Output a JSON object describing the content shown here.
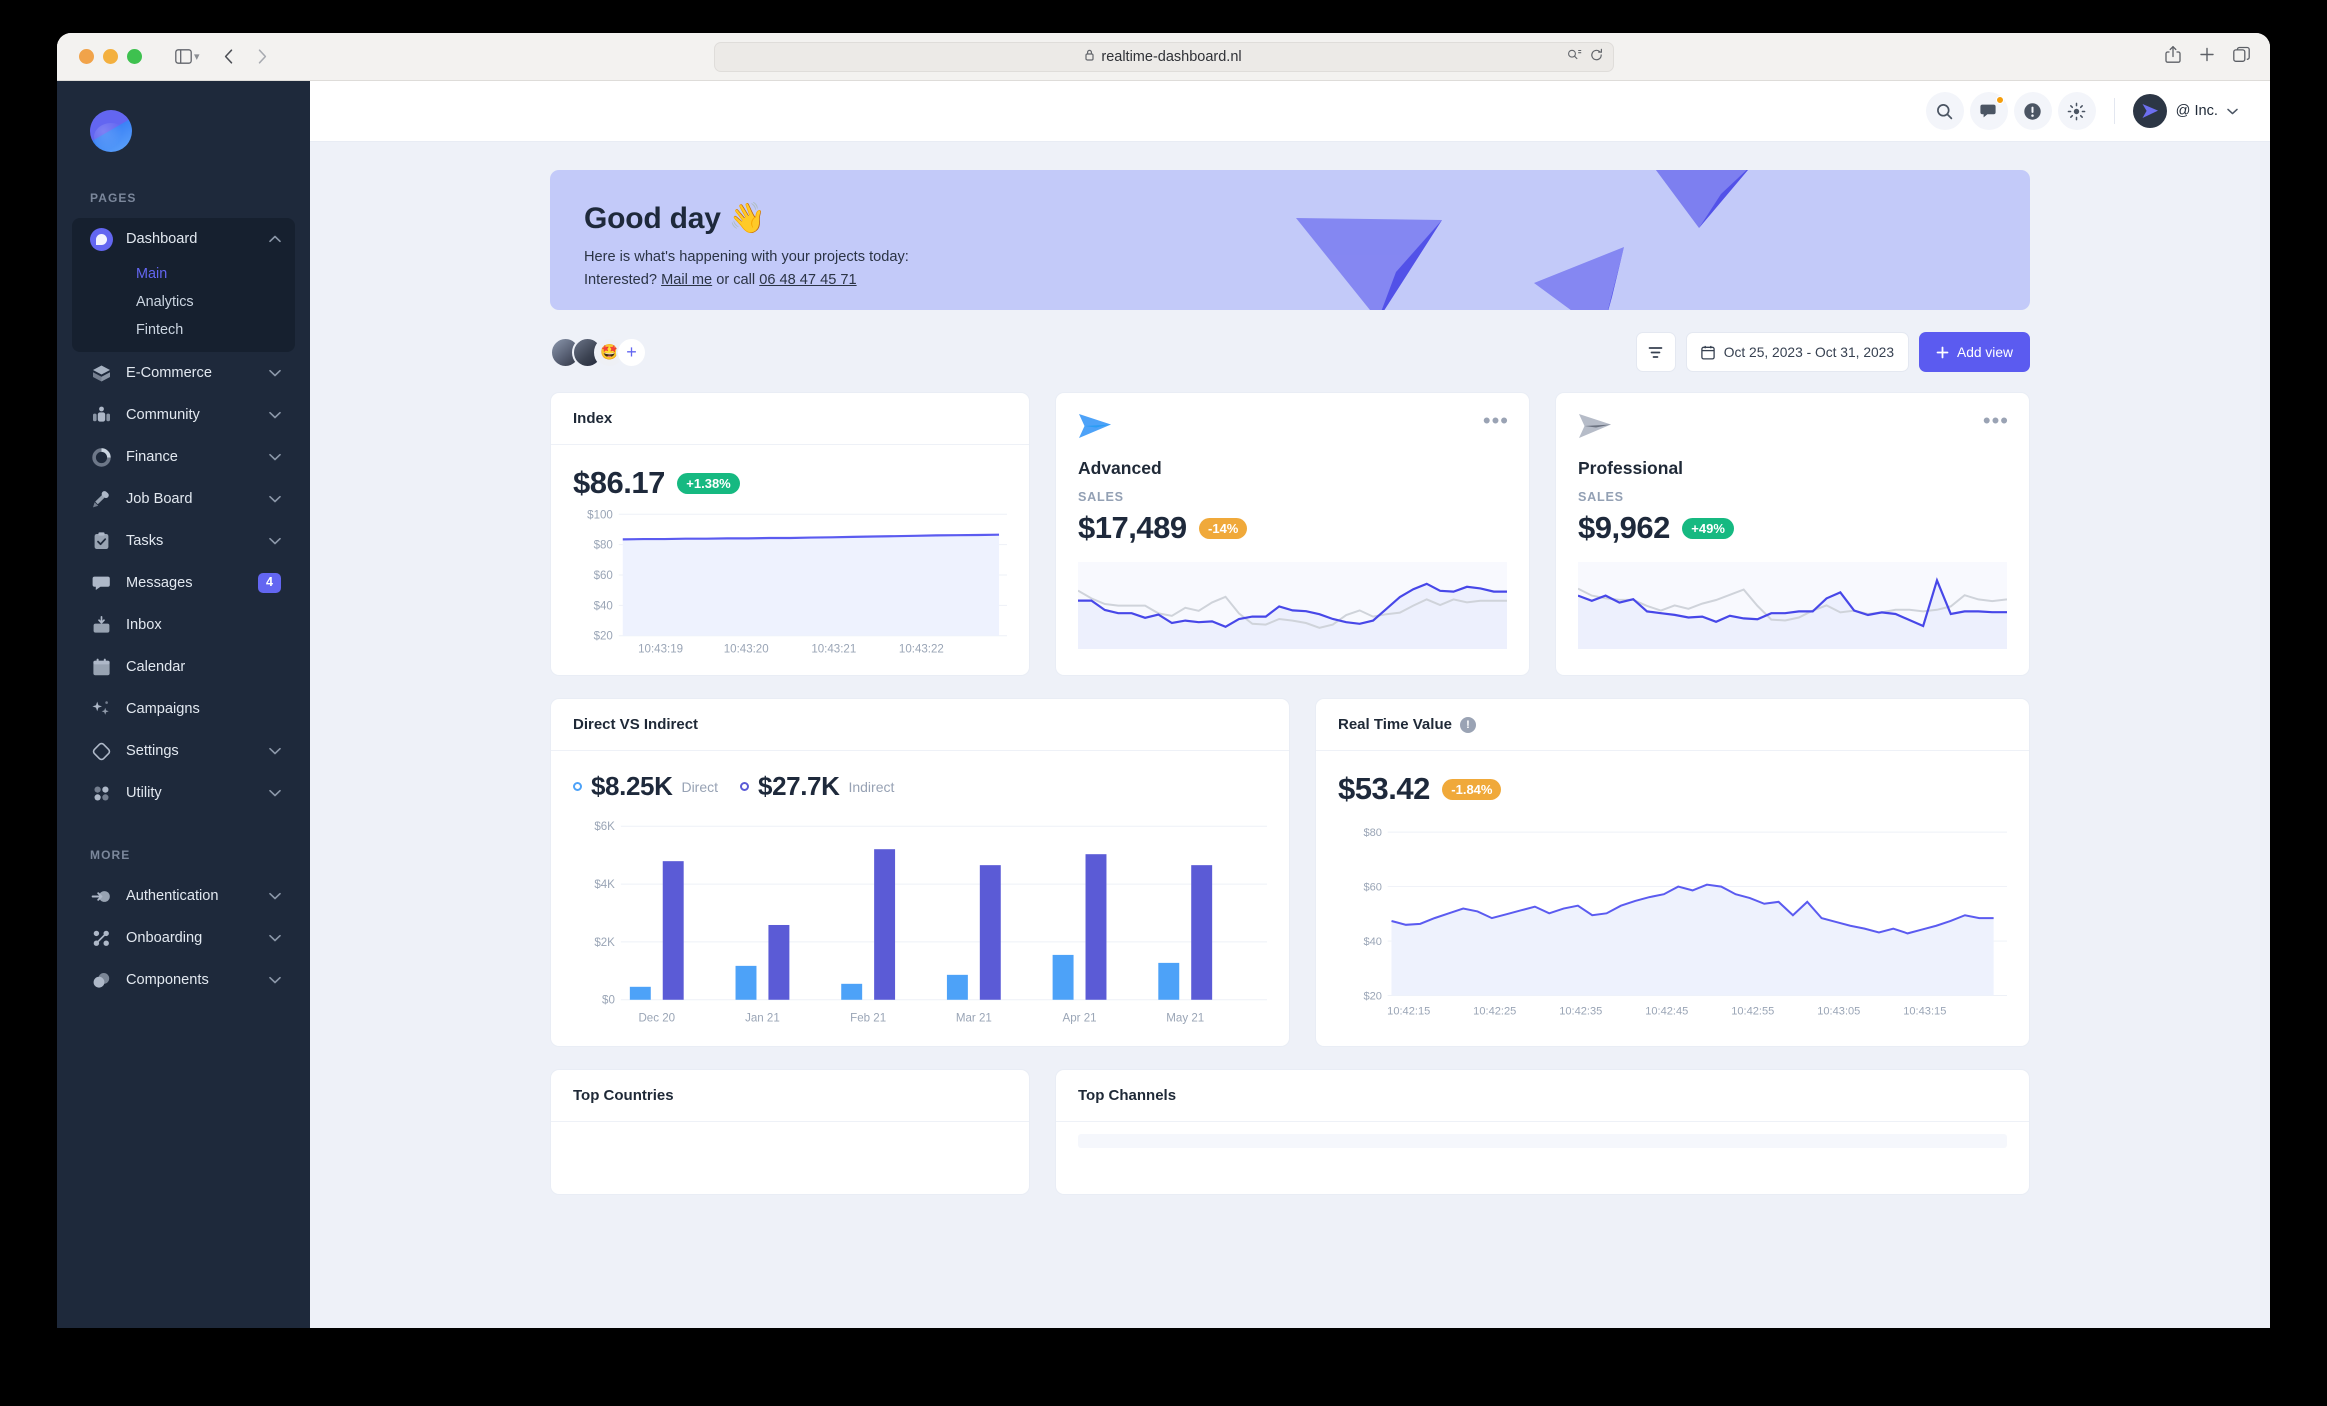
{
  "browser": {
    "url": "realtime-dashboard.nl",
    "lock_icon": "lock-icon",
    "back_icon": "back-icon",
    "forward_icon": "forward-icon",
    "sidebar_icon": "sidebar-toggle-icon",
    "share_icon": "share-icon",
    "newtab_icon": "new-tab-icon",
    "tabs_icon": "tab-overview-icon",
    "reload_icon": "reload-icon",
    "reader_icon": "reader-icon"
  },
  "sidebar": {
    "logo": "app-logo",
    "sections": [
      {
        "label": "PAGES"
      },
      {
        "label": "MORE"
      }
    ],
    "items": [
      {
        "label": "Dashboard",
        "icon": "dashboard-icon",
        "expanded": true,
        "chevron": "chevron-up",
        "children": [
          {
            "label": "Main",
            "current": true
          },
          {
            "label": "Analytics",
            "current": false
          },
          {
            "label": "Fintech",
            "current": false
          }
        ]
      },
      {
        "label": "E-Commerce",
        "icon": "cube-icon",
        "chevron": "chevron-down"
      },
      {
        "label": "Community",
        "icon": "people-icon",
        "chevron": "chevron-down"
      },
      {
        "label": "Finance",
        "icon": "donut-chart-icon",
        "chevron": "chevron-down"
      },
      {
        "label": "Job Board",
        "icon": "megaphone-icon",
        "chevron": "chevron-down"
      },
      {
        "label": "Tasks",
        "icon": "clipboard-check-icon",
        "chevron": "chevron-down"
      },
      {
        "label": "Messages",
        "icon": "chat-bubble-icon",
        "badge": "4"
      },
      {
        "label": "Inbox",
        "icon": "inbox-icon"
      },
      {
        "label": "Calendar",
        "icon": "calendar-icon"
      },
      {
        "label": "Campaigns",
        "icon": "sparkles-icon"
      },
      {
        "label": "Settings",
        "icon": "diamond-icon",
        "chevron": "chevron-down"
      },
      {
        "label": "Utility",
        "icon": "dots-grid-icon",
        "chevron": "chevron-down"
      }
    ],
    "more_items": [
      {
        "label": "Authentication",
        "icon": "login-arrow-icon",
        "chevron": "chevron-down"
      },
      {
        "label": "Onboarding",
        "icon": "nodes-icon",
        "chevron": "chevron-down"
      },
      {
        "label": "Components",
        "icon": "circles-icon",
        "chevron": "chevron-down"
      }
    ]
  },
  "topbar": {
    "search_icon": "search-icon",
    "messages_icon": "chat-icon",
    "alerts_icon": "exclamation-icon",
    "theme_icon": "brightness-icon",
    "avatar_icon": "user-avatar",
    "username": "@ Inc.",
    "user_chevron": "chevron-down-icon"
  },
  "banner": {
    "title": "Good day",
    "emoji": "👋",
    "line1": "Here is what's happening with your projects today:",
    "line2_prefix": "Interested? ",
    "mail_link": "Mail me",
    "line2_mid": " or call ",
    "phone_link": "06 48 47 45 71",
    "bg_color": "#c3caf9"
  },
  "toolbar": {
    "avatars": [
      "avatar-1",
      "avatar-2",
      "🤩"
    ],
    "add_member_label": "+",
    "filter_icon": "filter-icon",
    "calendar_icon": "calendar-icon",
    "date_range": "Oct 25, 2023 - Oct 31, 2023",
    "add_view_label": "Add view",
    "add_view_icon": "plus-icon",
    "accent_color": "#5b5bf0"
  },
  "cards": {
    "index": {
      "title": "Index",
      "value": "$86.17",
      "change": "+1.38%",
      "change_tone": "green"
    },
    "advanced": {
      "logo": "plan-logo-blue",
      "name": "Advanced",
      "metric_label": "SALES",
      "value": "$17,489",
      "change": "-14%",
      "change_tone": "orange",
      "menu_icon": "more-horizontal-icon"
    },
    "professional": {
      "logo": "plan-logo-gray",
      "name": "Professional",
      "metric_label": "SALES",
      "value": "$9,962",
      "change": "+49%",
      "change_tone": "green",
      "menu_icon": "more-horizontal-icon"
    },
    "direct_vs_indirect": {
      "title": "Direct VS Indirect",
      "direct_value": "$8.25K",
      "direct_label": "Direct",
      "indirect_value": "$27.7K",
      "indirect_label": "Indirect"
    },
    "real_time_value": {
      "title": "Real Time Value",
      "info_icon": "info-icon",
      "value": "$53.42",
      "change": "-1.84%",
      "change_tone": "orange"
    },
    "top_countries": {
      "title": "Top Countries"
    },
    "top_channels": {
      "title": "Top Channels"
    }
  },
  "chart_data": [
    {
      "id": "index_chart",
      "type": "line",
      "title": "Index",
      "xlabel": "",
      "ylabel": "",
      "ylim": [
        20,
        100
      ],
      "yticks": [
        20,
        40,
        60,
        80,
        100
      ],
      "ytick_labels": [
        "$20",
        "$40",
        "$60",
        "$80",
        "$100"
      ],
      "xtick_labels": [
        "10:43:19",
        "10:43:20",
        "10:43:21",
        "10:43:22"
      ],
      "grid": true,
      "legend": "none",
      "series": [
        {
          "name": "Index",
          "color": "#5b5bf0",
          "values": [
            84.9,
            85.0,
            85.0,
            85.1,
            85.1,
            85.2,
            85.2,
            85.3,
            85.3,
            85.4,
            85.5,
            85.6,
            85.7,
            85.8,
            85.9,
            86.0,
            86.05,
            86.1,
            86.17
          ]
        }
      ]
    },
    {
      "id": "advanced_sparkline",
      "type": "line",
      "title": "Advanced",
      "ylim": [
        0,
        100
      ],
      "grid": false,
      "legend": "none",
      "series": [
        {
          "name": "Sales",
          "color": "#4747e8",
          "values": [
            52,
            52,
            40,
            36,
            36,
            30,
            34,
            22,
            25,
            23,
            24,
            17,
            27,
            30,
            30,
            43,
            38,
            37,
            33,
            27,
            23,
            21,
            25,
            40,
            55,
            65,
            72,
            63,
            62,
            68,
            66,
            62,
            62
          ]
        },
        {
          "name": "Previous",
          "color": "#cfd3da",
          "values": [
            62,
            52,
            45,
            43,
            43,
            43,
            33,
            30,
            40,
            36,
            48,
            55,
            34,
            21,
            20,
            27,
            25,
            22,
            16,
            20,
            32,
            38,
            30,
            33,
            35,
            44,
            52,
            45,
            52,
            48,
            50,
            50,
            50
          ]
        }
      ]
    },
    {
      "id": "professional_sparkline",
      "type": "line",
      "title": "Professional",
      "ylim": [
        0,
        100
      ],
      "grid": false,
      "legend": "none",
      "series": [
        {
          "name": "Sales",
          "color": "#4747e8",
          "values": [
            58,
            52,
            58,
            50,
            54,
            40,
            38,
            36,
            33,
            34,
            28,
            35,
            32,
            31,
            38,
            38,
            40,
            40,
            55,
            62,
            45,
            40,
            42,
            40,
            33,
            26,
            78,
            40,
            43,
            43,
            42,
            42
          ]
        },
        {
          "name": "Previous",
          "color": "#cfd3da",
          "values": [
            66,
            58,
            54,
            52,
            52,
            45,
            40,
            46,
            42,
            48,
            52,
            58,
            64,
            45,
            28,
            27,
            30,
            38,
            44,
            36,
            38,
            34,
            36,
            40,
            40,
            38,
            40,
            44,
            57,
            52,
            50,
            52
          ]
        }
      ]
    },
    {
      "id": "direct_vs_indirect",
      "type": "bar",
      "title": "Direct VS Indirect",
      "categories": [
        "Dec 20",
        "Jan 21",
        "Feb 21",
        "Mar 21",
        "Apr 21",
        "May 21"
      ],
      "ylim": [
        0,
        6000
      ],
      "yticks": [
        0,
        2000,
        4000,
        6000
      ],
      "ytick_labels": [
        "$0",
        "$2K",
        "$4K",
        "$6K"
      ],
      "grid": true,
      "legend": "top",
      "series": [
        {
          "name": "Direct",
          "color": "#4da2f8",
          "total": "$8.25K",
          "values": [
            450,
            1180,
            560,
            870,
            1550,
            1260
          ]
        },
        {
          "name": "Indirect",
          "color": "#5b5bd6",
          "total": "$27.7K",
          "values": [
            4800,
            2600,
            5200,
            4650,
            5050,
            4650
          ]
        }
      ]
    },
    {
      "id": "real_time_value",
      "type": "area",
      "title": "Real Time Value",
      "ylim": [
        20,
        80
      ],
      "yticks": [
        20,
        40,
        60,
        80
      ],
      "ytick_labels": [
        "$20",
        "$40",
        "$60",
        "$80"
      ],
      "xtick_labels": [
        "10:42:15",
        "10:42:25",
        "10:42:35",
        "10:42:45",
        "10:42:55",
        "10:43:05",
        "10:43:15"
      ],
      "grid": true,
      "legend": "none",
      "series": [
        {
          "name": "Value",
          "color": "#5b5bf0",
          "values": [
            52.5,
            51.0,
            51.5,
            53.5,
            55.5,
            57.0,
            56.0,
            53.5,
            55.0,
            56.5,
            58.0,
            55.5,
            57.0,
            58.5,
            55.0,
            56.0,
            58.5,
            60.0,
            61.5,
            62.5,
            65.5,
            64.0,
            66.0,
            65.5,
            62.5,
            61.0,
            59.0,
            59.5,
            54.5,
            59.5,
            53.5,
            52.0,
            50.5,
            49.5,
            48.0,
            49.5,
            47.5,
            49.0,
            50.5,
            52.5,
            54.5,
            53.5
          ]
        }
      ]
    }
  ]
}
